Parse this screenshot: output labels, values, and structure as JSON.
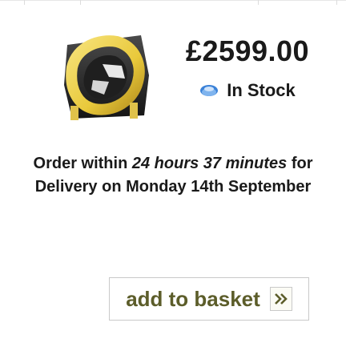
{
  "product": {
    "price": "£2599.00",
    "stock_status": "In Stock",
    "stock_icon": "in-stock-indicator-icon",
    "thumbnail": "product-thumbnail-image"
  },
  "delivery": {
    "prefix": "Order within ",
    "countdown": "24 hours 37 minutes",
    "middle": " for Delivery on ",
    "date": "Monday 14th September"
  },
  "actions": {
    "add_to_basket_label": "add to basket",
    "add_to_basket_icon": "chevron-right-icon"
  },
  "colors": {
    "text": "#1a1a1a",
    "button_text": "#5c5d2a",
    "stock_green": "#2e7bd1",
    "border": "#c9c9c9"
  }
}
